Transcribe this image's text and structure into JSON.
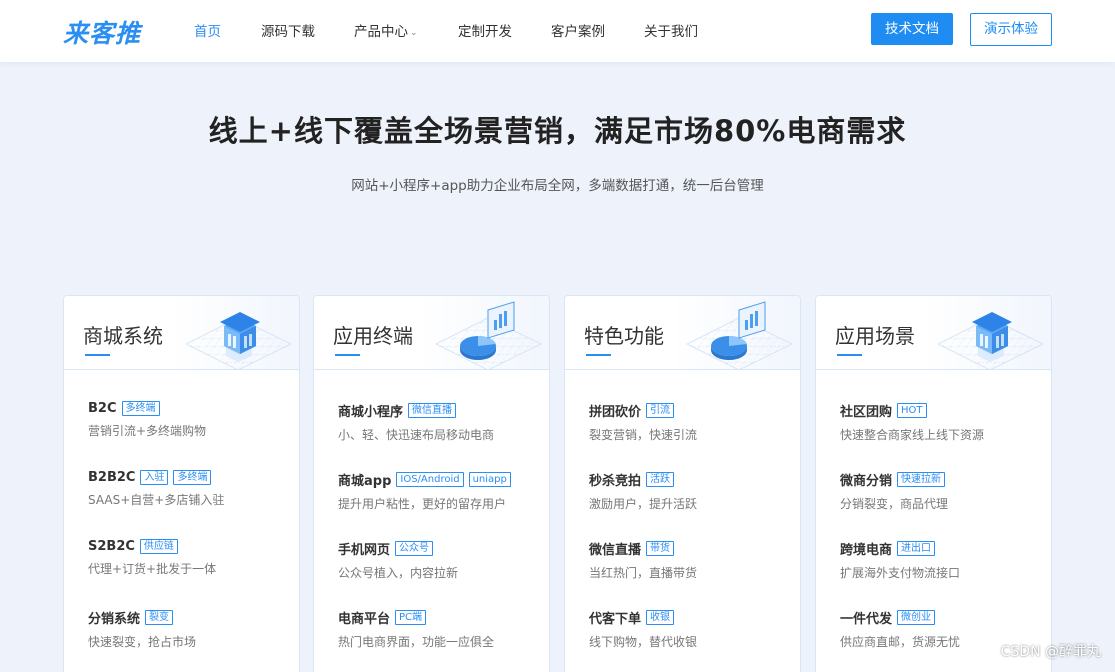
{
  "brand": {
    "logo_text": "来客推",
    "accent": "#2a8ef3"
  },
  "nav": {
    "items": [
      {
        "label": "首页",
        "active": true
      },
      {
        "label": "源码下载"
      },
      {
        "label": "产品中心",
        "has_dropdown": true
      },
      {
        "label": "定制开发"
      },
      {
        "label": "客户案例"
      },
      {
        "label": "关于我们"
      }
    ],
    "docs_button": "技术文档",
    "demo_button": "演示体验"
  },
  "hero": {
    "title": "线上+线下覆盖全场景营销，满足市场80%电商需求",
    "subtitle": "网站+小程序+app助力企业布局全网，多端数据打通，统一后台管理"
  },
  "cards": [
    {
      "title": "商城系统",
      "illustration": "shop-icon",
      "features": [
        {
          "name": "B2C",
          "tags": [
            "多终端"
          ],
          "desc": "营销引流+多终端购物"
        },
        {
          "name": "B2B2C",
          "tags": [
            "入驻",
            "多终端"
          ],
          "desc": "SAAS+自营+多店铺入驻"
        },
        {
          "name": "S2B2C",
          "tags": [
            "供应链"
          ],
          "desc": "代理+订货+批发于一体"
        },
        {
          "name": "分销系统",
          "tags": [
            "裂变"
          ],
          "desc": "快速裂变，抢占市场"
        }
      ]
    },
    {
      "title": "应用终端",
      "illustration": "chart-icon",
      "features": [
        {
          "name": "商城小程序",
          "tags": [
            "微信直播"
          ],
          "desc": "小、轻、快迅速布局移动电商"
        },
        {
          "name": "商城app",
          "tags": [
            "IOS/Android",
            "uniapp"
          ],
          "desc": "提升用户粘性，更好的留存用户"
        },
        {
          "name": "手机网页",
          "tags": [
            "公众号"
          ],
          "desc": "公众号植入，内容拉新"
        },
        {
          "name": "电商平台",
          "tags": [
            "PC端"
          ],
          "desc": "热门电商界面，功能一应俱全"
        }
      ]
    },
    {
      "title": "特色功能",
      "illustration": "chart-icon",
      "features": [
        {
          "name": "拼团砍价",
          "tags": [
            "引流"
          ],
          "desc": "裂变营销，快速引流"
        },
        {
          "name": "秒杀竞拍",
          "tags": [
            "活跃"
          ],
          "desc": "激励用户，提升活跃"
        },
        {
          "name": "微信直播",
          "tags": [
            "带货"
          ],
          "desc": "当红热门，直播带货"
        },
        {
          "name": "代客下单",
          "tags": [
            "收银"
          ],
          "desc": "线下购物，替代收银"
        }
      ]
    },
    {
      "title": "应用场景",
      "illustration": "shop-icon",
      "features": [
        {
          "name": "社区团购",
          "tags": [
            "HOT"
          ],
          "desc": "快速整合商家线上线下资源"
        },
        {
          "name": "微商分销",
          "tags": [
            "快速拉新"
          ],
          "desc": "分销裂变，商品代理"
        },
        {
          "name": "跨境电商",
          "tags": [
            "进出口"
          ],
          "desc": "扩展海外支付物流接口"
        },
        {
          "name": "一件代发",
          "tags": [
            "微创业"
          ],
          "desc": "供应商直邮，货源无忧"
        }
      ]
    }
  ],
  "watermark": "CSDN @醉罪丸"
}
